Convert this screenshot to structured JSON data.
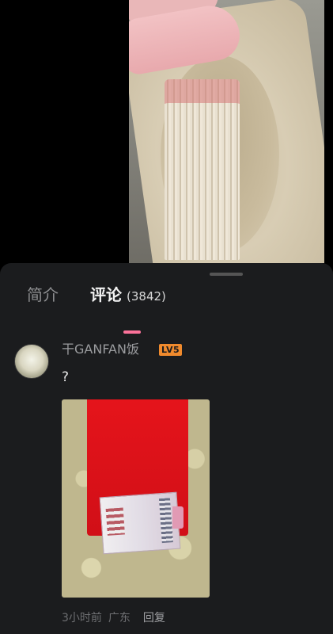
{
  "tabs": [
    {
      "label": "简介",
      "active": false
    },
    {
      "label": "评论",
      "count": "(3842)",
      "active": true
    }
  ],
  "accent_color": "#fb7299",
  "comment": {
    "username": "干GANFAN饭",
    "level": "LV5",
    "level_color": "#f08a2d",
    "text": "?",
    "time": "3小时前",
    "location": "广东",
    "reply_label": "回复"
  }
}
